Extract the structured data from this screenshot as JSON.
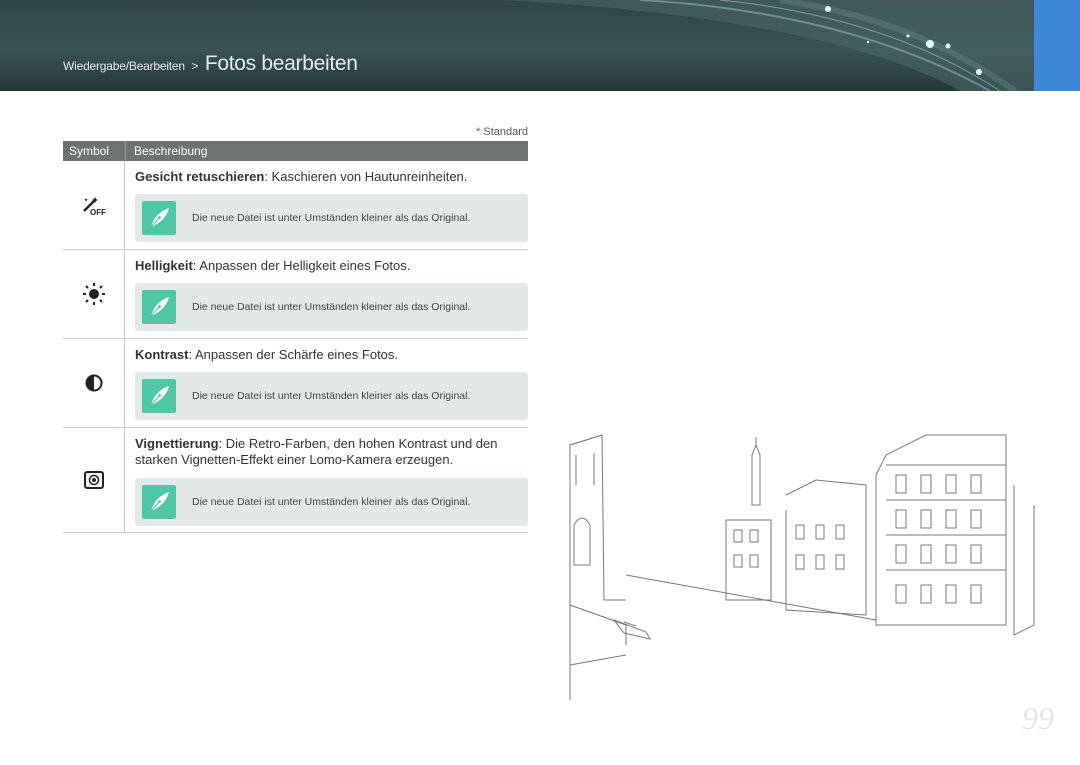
{
  "header": {
    "breadcrumb_parent": "Wiedergabe/Bearbeiten",
    "breadcrumb_separator": ">",
    "breadcrumb_current": "Fotos bearbeiten",
    "accent_color": "#3d86d8"
  },
  "standard_note": "* Standard",
  "table": {
    "col_symbol": "Symbol",
    "col_description": "Beschreibung",
    "rows": [
      {
        "icon": "face-retouch-off-icon",
        "title": "Gesicht retuschieren",
        "text": ": Kaschieren von Hautunreinheiten.",
        "note": "Die neue Datei ist unter Umständen kleiner als das Original."
      },
      {
        "icon": "brightness-icon",
        "title": "Helligkeit",
        "text": ": Anpassen der Helligkeit eines Fotos.",
        "note": "Die neue Datei ist unter Umständen kleiner als das Original."
      },
      {
        "icon": "contrast-icon",
        "title": "Kontrast",
        "text": ": Anpassen der Schärfe eines Fotos.",
        "note": "Die neue Datei ist unter Umständen kleiner als das Original."
      },
      {
        "icon": "vignetting-icon",
        "title": "Vignettierung",
        "text": ": Die Retro-Farben, den hohen Kontrast und den starken Vignetten-Effekt einer Lomo-Kamera erzeugen.",
        "note": "Die neue Datei ist unter Umständen kleiner als das Original."
      }
    ]
  },
  "page_number": "99"
}
